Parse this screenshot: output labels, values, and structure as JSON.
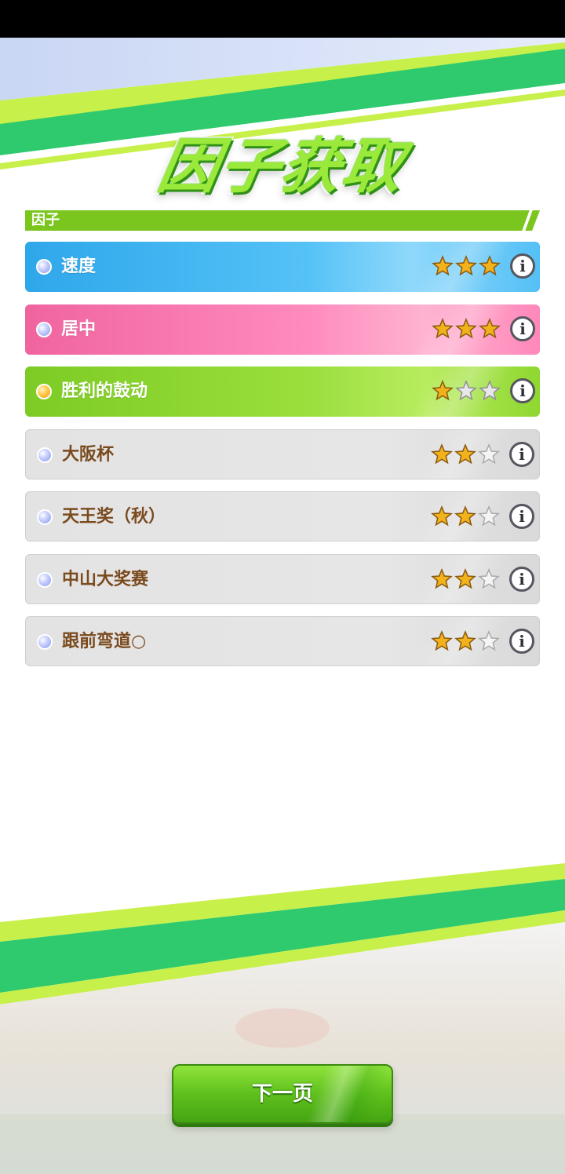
{
  "title": "因子获取",
  "section": {
    "label": "因子"
  },
  "factors": [
    {
      "label": "速度",
      "stars": 3,
      "color": "blue"
    },
    {
      "label": "居中",
      "stars": 3,
      "color": "pink"
    },
    {
      "label": "胜利的鼓动",
      "stars": 1,
      "color": "green"
    },
    {
      "label": "大阪杯",
      "stars": 2,
      "color": "gray"
    },
    {
      "label": "天王奖（秋）",
      "stars": 2,
      "color": "gray"
    },
    {
      "label": "中山大奖赛",
      "stars": 2,
      "color": "gray"
    },
    {
      "label": "跟前弯道○",
      "stars": 2,
      "color": "gray"
    }
  ],
  "max_stars": 3,
  "info_icon": "i",
  "next_button": {
    "label": "下一页"
  },
  "colors": {
    "accent_green": "#7AC61E",
    "star_gold": "#F2B21C",
    "label_brown": "#7a4a1e"
  }
}
